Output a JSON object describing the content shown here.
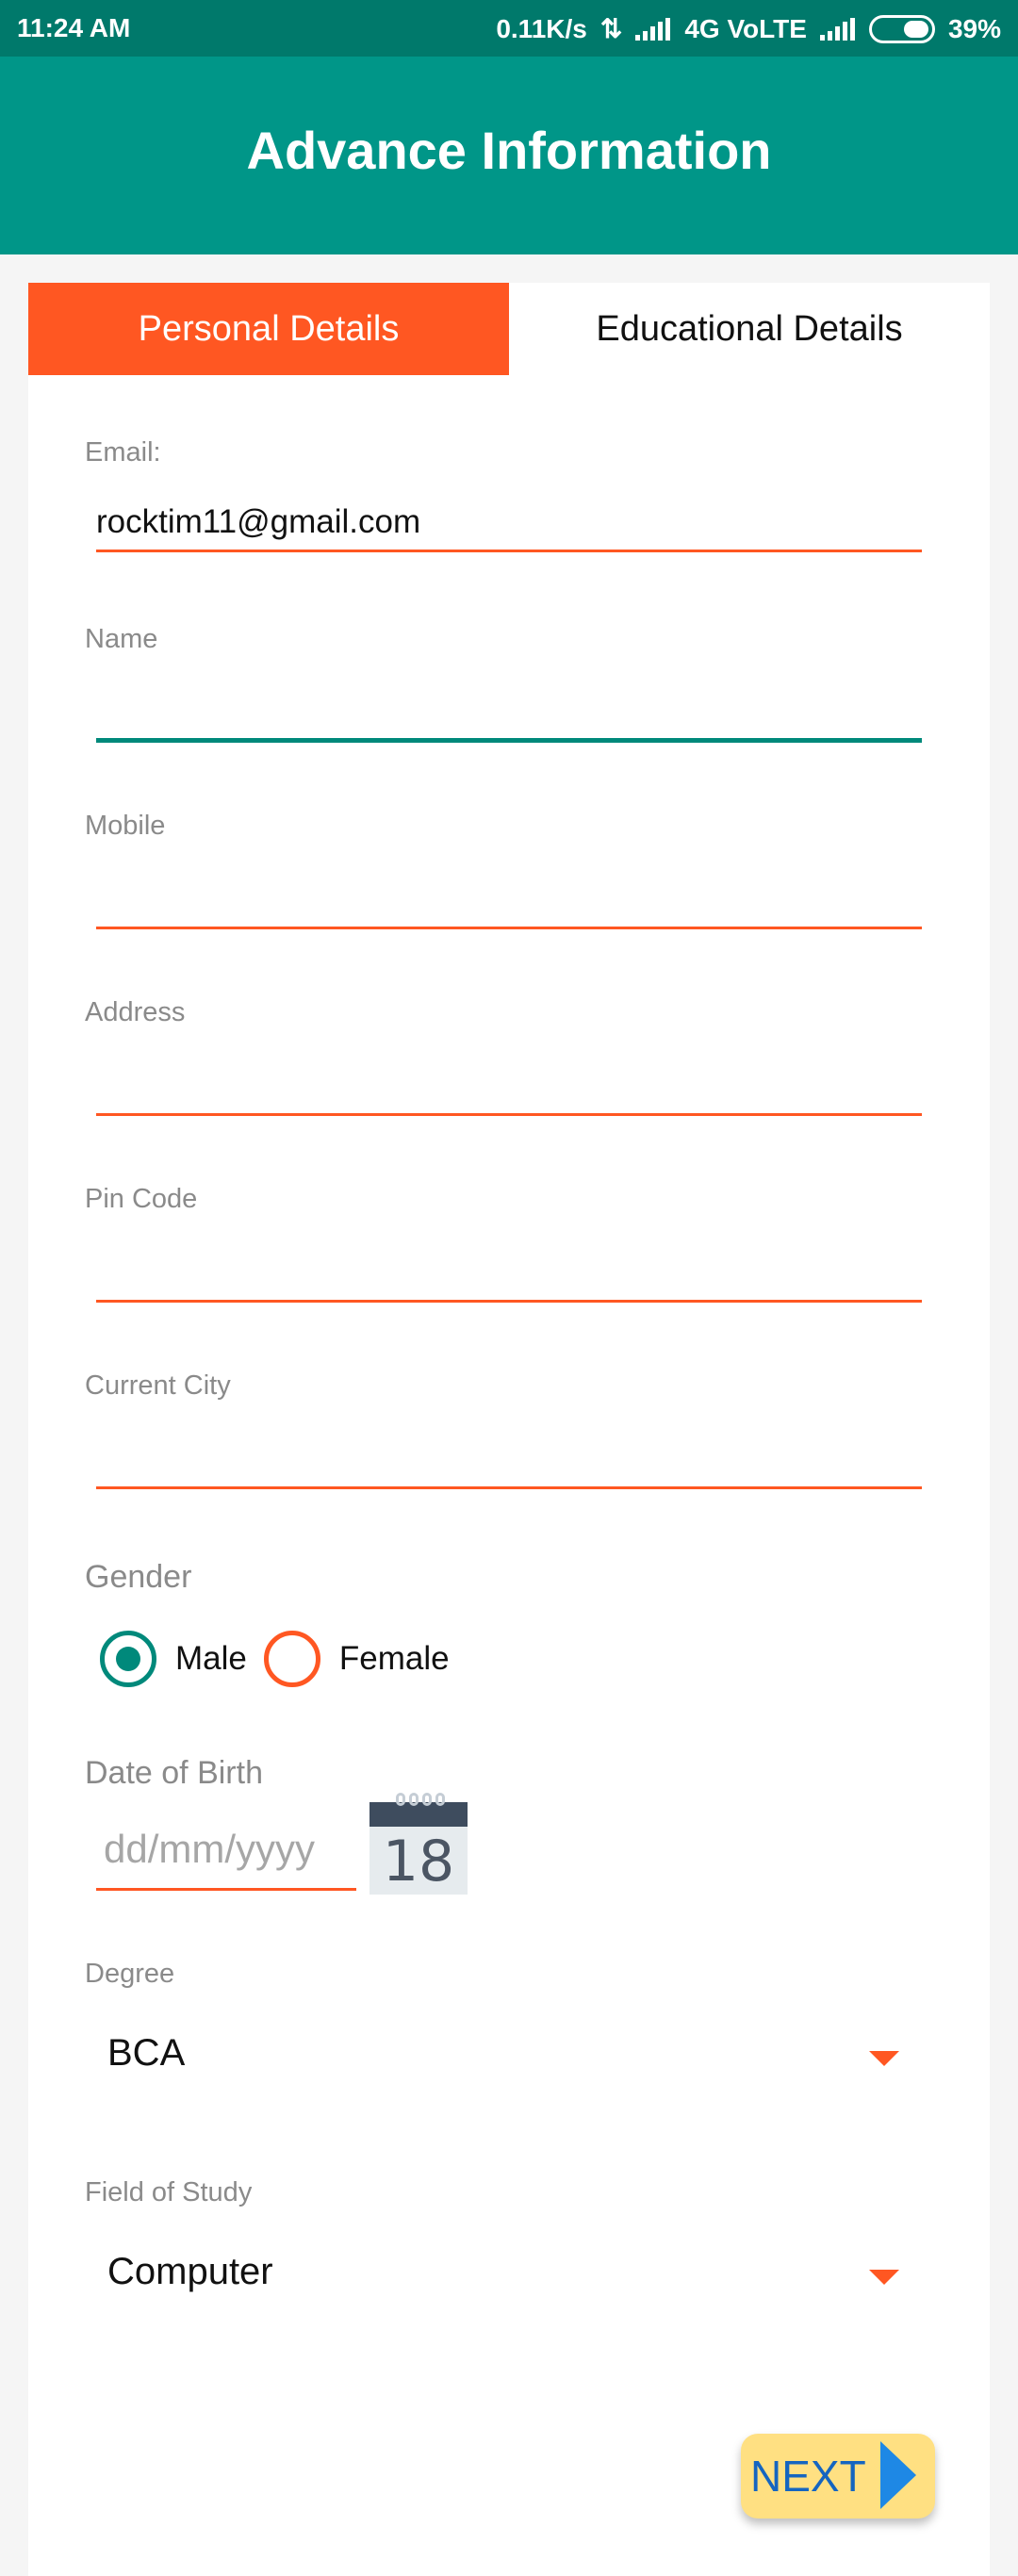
{
  "status_bar": {
    "time": "11:24 AM",
    "speed": "0.11K/s",
    "network": "4G VoLTE",
    "battery": "39%"
  },
  "app_bar": {
    "title": "Advance Information"
  },
  "tabs": [
    {
      "label": "Personal Details",
      "active": true
    },
    {
      "label": "Educational Details",
      "active": false
    }
  ],
  "form": {
    "email": {
      "label": "Email:",
      "value": "rocktim11@gmail.com"
    },
    "name": {
      "label": "Name",
      "value": ""
    },
    "mobile": {
      "label": "Mobile",
      "value": ""
    },
    "address": {
      "label": "Address",
      "value": ""
    },
    "pin_code": {
      "label": "Pin Code",
      "value": ""
    },
    "current_city": {
      "label": "Current City",
      "value": ""
    },
    "gender": {
      "label": "Gender",
      "options": [
        "Male",
        "Female"
      ],
      "selected": "Male"
    },
    "dob": {
      "label": "Date of Birth",
      "placeholder": "dd/mm/yyyy",
      "calendar_day": "18"
    },
    "degree": {
      "label": "Degree",
      "value": "BCA"
    },
    "field_of_study": {
      "label": "Field of Study",
      "value": "Computer"
    }
  },
  "next_button": {
    "label": "NEXT"
  },
  "colors": {
    "primary": "#009688",
    "status_bar": "#00796b",
    "accent": "#ff5722",
    "next_bg": "#ffe082",
    "next_text": "#1565c0"
  },
  "icons": [
    "data-transfer-icon",
    "signal-icon",
    "battery-icon",
    "calendar-icon",
    "dropdown-arrow-icon",
    "next-arrow-icon"
  ]
}
